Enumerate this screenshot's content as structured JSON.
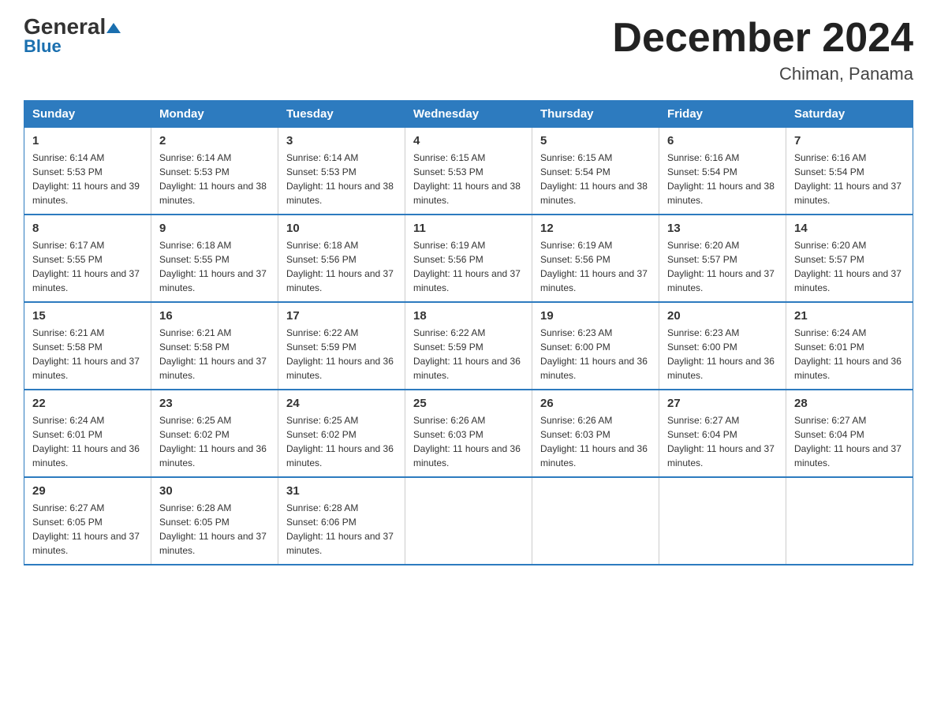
{
  "header": {
    "logo_general": "General",
    "logo_blue": "Blue",
    "month_title": "December 2024",
    "location": "Chiman, Panama"
  },
  "days_of_week": [
    "Sunday",
    "Monday",
    "Tuesday",
    "Wednesday",
    "Thursday",
    "Friday",
    "Saturday"
  ],
  "weeks": [
    [
      {
        "day": "1",
        "sunrise": "6:14 AM",
        "sunset": "5:53 PM",
        "daylight": "11 hours and 39 minutes."
      },
      {
        "day": "2",
        "sunrise": "6:14 AM",
        "sunset": "5:53 PM",
        "daylight": "11 hours and 38 minutes."
      },
      {
        "day": "3",
        "sunrise": "6:14 AM",
        "sunset": "5:53 PM",
        "daylight": "11 hours and 38 minutes."
      },
      {
        "day": "4",
        "sunrise": "6:15 AM",
        "sunset": "5:53 PM",
        "daylight": "11 hours and 38 minutes."
      },
      {
        "day": "5",
        "sunrise": "6:15 AM",
        "sunset": "5:54 PM",
        "daylight": "11 hours and 38 minutes."
      },
      {
        "day": "6",
        "sunrise": "6:16 AM",
        "sunset": "5:54 PM",
        "daylight": "11 hours and 38 minutes."
      },
      {
        "day": "7",
        "sunrise": "6:16 AM",
        "sunset": "5:54 PM",
        "daylight": "11 hours and 37 minutes."
      }
    ],
    [
      {
        "day": "8",
        "sunrise": "6:17 AM",
        "sunset": "5:55 PM",
        "daylight": "11 hours and 37 minutes."
      },
      {
        "day": "9",
        "sunrise": "6:18 AM",
        "sunset": "5:55 PM",
        "daylight": "11 hours and 37 minutes."
      },
      {
        "day": "10",
        "sunrise": "6:18 AM",
        "sunset": "5:56 PM",
        "daylight": "11 hours and 37 minutes."
      },
      {
        "day": "11",
        "sunrise": "6:19 AM",
        "sunset": "5:56 PM",
        "daylight": "11 hours and 37 minutes."
      },
      {
        "day": "12",
        "sunrise": "6:19 AM",
        "sunset": "5:56 PM",
        "daylight": "11 hours and 37 minutes."
      },
      {
        "day": "13",
        "sunrise": "6:20 AM",
        "sunset": "5:57 PM",
        "daylight": "11 hours and 37 minutes."
      },
      {
        "day": "14",
        "sunrise": "6:20 AM",
        "sunset": "5:57 PM",
        "daylight": "11 hours and 37 minutes."
      }
    ],
    [
      {
        "day": "15",
        "sunrise": "6:21 AM",
        "sunset": "5:58 PM",
        "daylight": "11 hours and 37 minutes."
      },
      {
        "day": "16",
        "sunrise": "6:21 AM",
        "sunset": "5:58 PM",
        "daylight": "11 hours and 37 minutes."
      },
      {
        "day": "17",
        "sunrise": "6:22 AM",
        "sunset": "5:59 PM",
        "daylight": "11 hours and 36 minutes."
      },
      {
        "day": "18",
        "sunrise": "6:22 AM",
        "sunset": "5:59 PM",
        "daylight": "11 hours and 36 minutes."
      },
      {
        "day": "19",
        "sunrise": "6:23 AM",
        "sunset": "6:00 PM",
        "daylight": "11 hours and 36 minutes."
      },
      {
        "day": "20",
        "sunrise": "6:23 AM",
        "sunset": "6:00 PM",
        "daylight": "11 hours and 36 minutes."
      },
      {
        "day": "21",
        "sunrise": "6:24 AM",
        "sunset": "6:01 PM",
        "daylight": "11 hours and 36 minutes."
      }
    ],
    [
      {
        "day": "22",
        "sunrise": "6:24 AM",
        "sunset": "6:01 PM",
        "daylight": "11 hours and 36 minutes."
      },
      {
        "day": "23",
        "sunrise": "6:25 AM",
        "sunset": "6:02 PM",
        "daylight": "11 hours and 36 minutes."
      },
      {
        "day": "24",
        "sunrise": "6:25 AM",
        "sunset": "6:02 PM",
        "daylight": "11 hours and 36 minutes."
      },
      {
        "day": "25",
        "sunrise": "6:26 AM",
        "sunset": "6:03 PM",
        "daylight": "11 hours and 36 minutes."
      },
      {
        "day": "26",
        "sunrise": "6:26 AM",
        "sunset": "6:03 PM",
        "daylight": "11 hours and 36 minutes."
      },
      {
        "day": "27",
        "sunrise": "6:27 AM",
        "sunset": "6:04 PM",
        "daylight": "11 hours and 37 minutes."
      },
      {
        "day": "28",
        "sunrise": "6:27 AM",
        "sunset": "6:04 PM",
        "daylight": "11 hours and 37 minutes."
      }
    ],
    [
      {
        "day": "29",
        "sunrise": "6:27 AM",
        "sunset": "6:05 PM",
        "daylight": "11 hours and 37 minutes."
      },
      {
        "day": "30",
        "sunrise": "6:28 AM",
        "sunset": "6:05 PM",
        "daylight": "11 hours and 37 minutes."
      },
      {
        "day": "31",
        "sunrise": "6:28 AM",
        "sunset": "6:06 PM",
        "daylight": "11 hours and 37 minutes."
      },
      null,
      null,
      null,
      null
    ]
  ]
}
